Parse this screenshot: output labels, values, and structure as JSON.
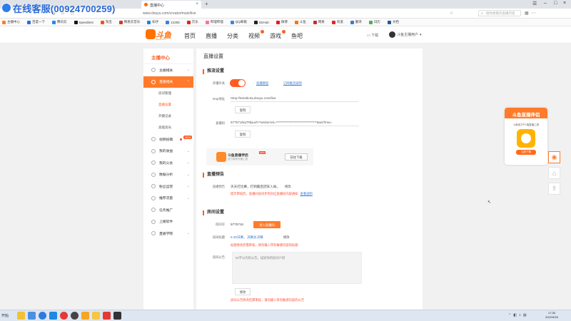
{
  "watermark": {
    "text": "在线客服(00924700259)"
  },
  "browser": {
    "tab_title": "直播中心",
    "new_tab": "+",
    "url": "www.douyu.com/creator/main/live",
    "search_placeholder": "搜你想看的直播内容",
    "bookmarks": [
      {
        "label": "主播中心",
        "color": "#ff7b2b"
      },
      {
        "label": "百度一下",
        "color": "#2e6be6"
      },
      {
        "label": "腾讯云",
        "color": "#1d8cf8"
      },
      {
        "label": "Speedtest",
        "color": "#141526"
      },
      {
        "label": "淘宝",
        "color": "#ff5000"
      },
      {
        "label": "网易云音乐",
        "color": "#d13a2f"
      },
      {
        "label": "知乎",
        "color": "#0f88eb"
      },
      {
        "label": "12306",
        "color": "#3c7fe0"
      },
      {
        "label": "京东",
        "color": "#e1251b"
      },
      {
        "label": "哔哩哔哩",
        "color": "#fb7299"
      },
      {
        "label": "QQ邮箱",
        "color": "#3b86e3"
      },
      {
        "label": "GitHub",
        "color": "#222"
      },
      {
        "label": "微博",
        "color": "#e6162d"
      },
      {
        "label": "斗鱼",
        "color": "#ff7200"
      },
      {
        "label": "网易",
        "color": "#c62e2e"
      },
      {
        "label": "有道",
        "color": "#e5242b"
      },
      {
        "label": "翻译",
        "color": "#3a7bd5"
      },
      {
        "label": "日历",
        "color": "#4caf50"
      },
      {
        "label": "文档",
        "color": "#2b579a"
      }
    ]
  },
  "site": {
    "logo_text": "斗鱼",
    "logo_sub": "douyu.com",
    "nav": [
      "首页",
      "直播",
      "分类",
      "视频",
      "游戏",
      "鱼吧"
    ],
    "download": "下载",
    "username": "斗鱼主播用户"
  },
  "sidebar": {
    "title": "主播中心",
    "items": [
      {
        "label": "主播相关"
      },
      {
        "label": "直播相关"
      },
      {
        "label": "房间管理"
      },
      {
        "label": "直播设置"
      },
      {
        "label": "开播记录"
      },
      {
        "label": "高能高光"
      },
      {
        "label": "视频投稿",
        "tag": "NEW"
      },
      {
        "label": "我的收益"
      },
      {
        "label": "我的公会"
      },
      {
        "label": "数据分析"
      },
      {
        "label": "粉丝运营"
      },
      {
        "label": "推荐流量"
      },
      {
        "label": "任务推广"
      },
      {
        "label": "上播软件"
      },
      {
        "label": "直播学院"
      }
    ]
  },
  "main": {
    "page_title": "直播设置",
    "push": {
      "heading": "推流设置",
      "switch_label": "开播开关",
      "link1": "直播教程",
      "link2": "订阅推流说明",
      "rtmp_label": "rtmp地址",
      "rtmp_value": "rtmp://sendtc3a.douyu.com/live",
      "copy1": "复制",
      "code_label": "直播码",
      "code_value": "5775716rqTNlyudY?wsSecret=********************************&wsTime=",
      "copy2": "复制",
      "banner_title": "斗鱼直播伴侣",
      "banner_new": "NEW",
      "banner_sub": "官方推荐开播工具",
      "banner_btn": "前往下载"
    },
    "preview": {
      "heading": "直播预告",
      "label": "直播预告",
      "text": "天天打比赛，打到最后冠军入局。",
      "edit": "修改",
      "warn": "提示审核后，直播间会同步到对应直播间内容通知",
      "warn_link": "查看说明"
    },
    "room": {
      "heading": "房间设置",
      "id_label": "房间号",
      "id_value": "5775716",
      "id_btn": "进入直播间",
      "title_label": "房间标题",
      "title_value": "9.30日赛，决赛总决赛",
      "title_edit": "修改",
      "title_warn": "标题修改后需审核，请勿输入带有敏感内容的标题",
      "notice_label": "房间公告",
      "notice_placeholder": "50字以内的公告，描述你的房间介绍",
      "notice_edit": "修改",
      "notice_warn": "房间公告修改后需审核，请勿输入带有敏感内容的公告"
    }
  },
  "float_ad": {
    "title": "斗鱼直播伴侣",
    "sub": "斗鱼官方PC端直播工具",
    "btn": "立即下载"
  },
  "taskbar": {
    "start": "开始",
    "time": "17:35",
    "date": "2022/9/26"
  }
}
